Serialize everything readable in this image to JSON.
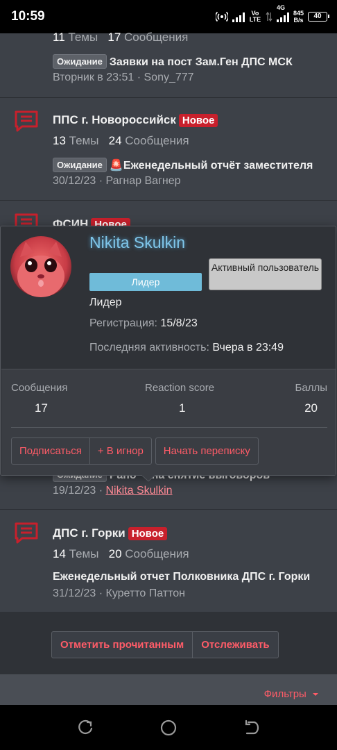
{
  "status_bar": {
    "time": "10:59",
    "network": "Vo LTE",
    "net4g": "4G",
    "speed_value": "845",
    "speed_unit": "B/s",
    "battery": "40"
  },
  "nodes": [
    {
      "threads_count": "11",
      "threads_label": "Темы",
      "posts_count": "17",
      "posts_label": "Сообщения",
      "prefix": "Ожидание",
      "latest_title": "Заявки на пост Зам.Ген ДПС МСК",
      "latest_meta": "Вторник в 23:51 · Sony_777"
    },
    {
      "title": "ППС г. Новороссийск",
      "badge": "Новое",
      "threads_count": "13",
      "threads_label": "Темы",
      "posts_count": "24",
      "posts_label": "Сообщения",
      "prefix": "Ожидание",
      "latest_title": "🚨Еженедельный отчёт заместителя",
      "latest_meta": "30/12/23 · Рагнар Вагнер"
    },
    {
      "title": "ФСИН",
      "badge": "Новое",
      "prefix": "Ожидание",
      "latest_title_partial": "Рапо",
      "latest_title_tail": "на снятие выговоров",
      "latest_meta_date": "19/12/23 · ",
      "latest_meta_user": "Nikita Skulkin"
    },
    {
      "title": "ДПС г. Горки",
      "badge": "Новое",
      "threads_count": "14",
      "threads_label": "Темы",
      "posts_count": "20",
      "posts_label": "Сообщения",
      "latest_title": "Еженедельный отчет Полковника ДПС г. Горки",
      "latest_meta": "31/12/23 · Куретто Паттон"
    }
  ],
  "actions": {
    "mark_read": "Отметить прочитанным",
    "watch": "Отслеживать",
    "filters": "Фильтры"
  },
  "profile": {
    "username": "Nikita Skulkin",
    "banner_role": "Лидер",
    "banner_active": "Активный пользователь",
    "user_title": "Лидер",
    "registered_label": "Регистрация:",
    "registered_value": "15/8/23",
    "last_seen_label": "Последняя активность:",
    "last_seen_value": "Вчера в 23:49",
    "stats": [
      {
        "label": "Сообщения",
        "value": "17"
      },
      {
        "label": "Reaction score",
        "value": "1"
      },
      {
        "label": "Баллы",
        "value": "20"
      }
    ],
    "buttons": {
      "follow": "Подписаться",
      "ignore": "+ В игнор",
      "message": "Начать переписку"
    }
  },
  "colors": {
    "accent": "#ff5c68",
    "badge_new": "#c8202c",
    "icon_red": "#c8202c",
    "username_blue": "#7fc6ea",
    "banner_blue": "#6fbbd9"
  }
}
